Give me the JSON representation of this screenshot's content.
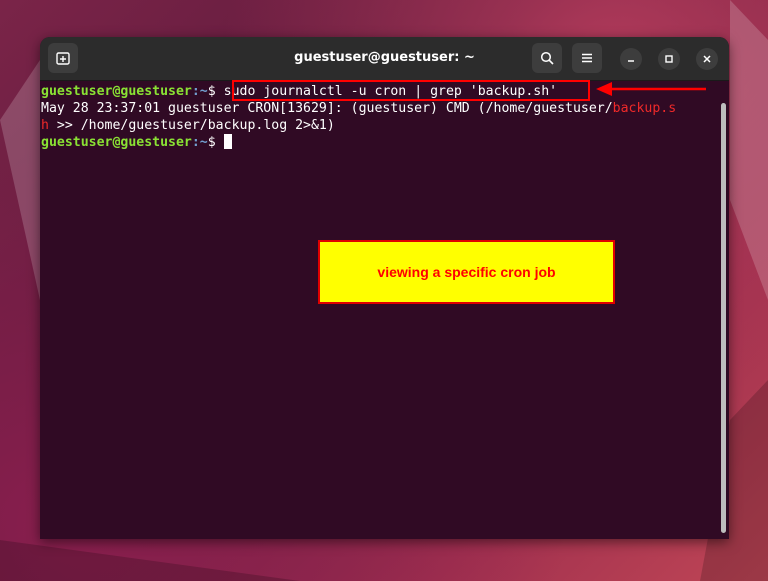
{
  "window": {
    "title": "guestuser@guestuser: ~",
    "icons": [
      "new-tab-icon",
      "search-icon",
      "menu-icon",
      "minimize-icon",
      "maximize-icon",
      "close-icon"
    ]
  },
  "terminal": {
    "line1": {
      "user": "guestuser@guestuser",
      "path": ":~",
      "symbol": "$ ",
      "command": "sudo journalctl -u cron | grep 'backup.sh'"
    },
    "line2": {
      "text_before": "May 28 23:37:01 guestuser CRON[13629]: (guestuser) CMD (/home/guestuser/",
      "highlight": "backup.s"
    },
    "line3": {
      "highlight": "h",
      "text_after": " >> /home/guestuser/backup.log 2>&1)"
    },
    "line4": {
      "user": "guestuser@guestuser",
      "path": ":~",
      "symbol": "$ "
    }
  },
  "annotation": {
    "label": "viewing a specific cron job",
    "box_color": "#ffff00",
    "text_color": "#ff0000",
    "highlight_color": "#ff0000"
  },
  "colors": {
    "terminal_bg": "#300a24",
    "prompt_green": "#8ae234",
    "path_blue": "#729fcf",
    "match_red": "#ef2929"
  }
}
